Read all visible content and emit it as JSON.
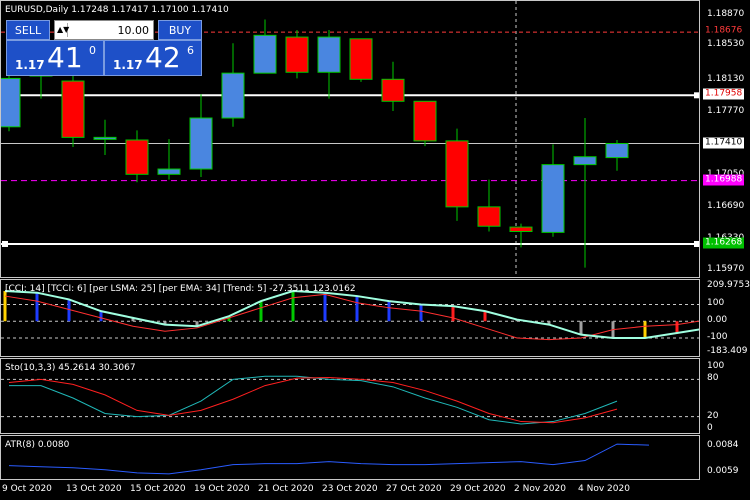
{
  "chart_data": {
    "type": "candlestick",
    "symbol_header": "EURUSD,Daily  1.17248 1.17417 1.17100 1.17410",
    "x_labels": [
      "9 Oct 2020",
      "13 Oct 2020",
      "15 Oct 2020",
      "19 Oct 2020",
      "21 Oct 2020",
      "23 Oct 2020",
      "27 Oct 2020",
      "29 Oct 2020",
      "2 Nov 2020",
      "4 Nov 2020"
    ],
    "ylim": [
      1.1587,
      1.1903
    ],
    "candles": [
      {
        "o": 1.176,
        "h": 1.1825,
        "l": 1.1755,
        "c": 1.1815
      },
      {
        "o": 1.182,
        "h": 1.1836,
        "l": 1.1792,
        "c": 1.1818
      },
      {
        "o": 1.1812,
        "h": 1.1822,
        "l": 1.1737,
        "c": 1.1748
      },
      {
        "o": 1.1748,
        "h": 1.1768,
        "l": 1.1728,
        "c": 1.1748
      },
      {
        "o": 1.1745,
        "h": 1.1756,
        "l": 1.1697,
        "c": 1.1706
      },
      {
        "o": 1.1706,
        "h": 1.1746,
        "l": 1.17,
        "c": 1.1712
      },
      {
        "o": 1.1712,
        "h": 1.1797,
        "l": 1.1703,
        "c": 1.177
      },
      {
        "o": 1.177,
        "h": 1.1855,
        "l": 1.176,
        "c": 1.1821
      },
      {
        "o": 1.1821,
        "h": 1.1882,
        "l": 1.1821,
        "c": 1.1864
      },
      {
        "o": 1.1862,
        "h": 1.187,
        "l": 1.1815,
        "c": 1.1822
      },
      {
        "o": 1.1822,
        "h": 1.187,
        "l": 1.1792,
        "c": 1.1862
      },
      {
        "o": 1.186,
        "h": 1.186,
        "l": 1.1811,
        "c": 1.1814
      },
      {
        "o": 1.1814,
        "h": 1.1834,
        "l": 1.1778,
        "c": 1.1789
      },
      {
        "o": 1.1789,
        "h": 1.1789,
        "l": 1.1738,
        "c": 1.1744
      },
      {
        "o": 1.1744,
        "h": 1.1758,
        "l": 1.1653,
        "c": 1.1669
      },
      {
        "o": 1.1669,
        "h": 1.17,
        "l": 1.1641,
        "c": 1.1647
      },
      {
        "o": 1.1646,
        "h": 1.165,
        "l": 1.1623,
        "c": 1.1641
      },
      {
        "o": 1.164,
        "h": 1.174,
        "l": 1.1635,
        "c": 1.1717
      },
      {
        "o": 1.1717,
        "h": 1.177,
        "l": 1.16,
        "c": 1.1726
      },
      {
        "o": 1.1725,
        "h": 1.1745,
        "l": 1.171,
        "c": 1.1741
      }
    ],
    "price_ticks": [
      "1.18870",
      "1.18530",
      "1.18130",
      "1.17770",
      "1.17410",
      "1.17050",
      "1.16690",
      "1.16330",
      "1.15970"
    ],
    "price_tags": [
      {
        "text": "1.18676",
        "value": 1.18676,
        "bg": "#000000",
        "fg": "#ff3b3b",
        "line": "#ff3b3b"
      },
      {
        "text": "1.17958",
        "value": 1.17958,
        "bg": "#ffffff",
        "fg": "#e00000",
        "line": "#ffffff"
      },
      {
        "text": "1.17410",
        "value": 1.1741,
        "bg": "#ffffff",
        "fg": "#000000",
        "line": "#c8c8c8"
      },
      {
        "text": "1.16988",
        "value": 1.16988,
        "bg": "#ff00ff",
        "fg": "#ffffff",
        "line": "#ff00ff"
      },
      {
        "text": "1.16268",
        "value": 1.16268,
        "bg": "#00c000",
        "fg": "#ffffff",
        "line": "#ffffff"
      }
    ],
    "hlines": [
      {
        "value": 1.18676,
        "color": "#ff3b3b",
        "dash": "4,3",
        "width": 1
      },
      {
        "value": 1.17958,
        "color": "#ffffff",
        "dash": "",
        "width": 2
      },
      {
        "value": 1.1741,
        "color": "#c8c8c8",
        "dash": "",
        "width": 1
      },
      {
        "value": 1.16988,
        "color": "#ff00ff",
        "dash": "6,4",
        "width": 1
      },
      {
        "value": 1.16268,
        "color": "#ffffff",
        "dash": "",
        "width": 2
      }
    ],
    "cci": {
      "label": "[CCI: 14] [TCCI: 6] [per LSMA: 25] [per EMA: 34] [Trend: 5] -27.3511 123.0162",
      "ylim": [
        -183.409,
        209.9753
      ],
      "ticks": [
        "209.9753",
        "100",
        "0.00",
        "-100",
        "-183.409"
      ],
      "cci": [
        150,
        120,
        70,
        20,
        -30,
        -60,
        -40,
        20,
        80,
        140,
        160,
        110,
        80,
        60,
        20,
        -40,
        -100,
        -110,
        -100,
        -50,
        -30,
        -20,
        10,
        70
      ],
      "tcci": [
        180,
        170,
        130,
        60,
        20,
        -20,
        -30,
        30,
        120,
        180,
        170,
        150,
        120,
        100,
        90,
        60,
        10,
        -20,
        -80,
        -100,
        -100,
        -70,
        -40,
        -20
      ],
      "hist_colors": [
        "yellow",
        "blue",
        "blue",
        "blue",
        "gray",
        "gray",
        "gray",
        "green",
        "green",
        "green",
        "blue",
        "blue",
        "blue",
        "blue",
        "red",
        "red",
        "gray",
        "gray",
        "gray",
        "gray",
        "yellow",
        "red",
        "red",
        "red"
      ]
    },
    "sto": {
      "label": "Sto(10,3,3) 45.2614 30.3067",
      "ticks": [
        "100",
        "80",
        "20",
        "0"
      ],
      "ylim": [
        0,
        100
      ],
      "main": [
        70,
        70,
        50,
        25,
        20,
        22,
        45,
        80,
        85,
        85,
        80,
        78,
        68,
        50,
        35,
        15,
        8,
        12,
        25,
        45
      ],
      "signal": [
        75,
        80,
        72,
        55,
        30,
        22,
        30,
        48,
        70,
        82,
        83,
        80,
        75,
        62,
        45,
        25,
        12,
        10,
        18,
        32
      ]
    },
    "atr": {
      "label": "ATR(8) 0.0080",
      "ticks": [
        "0.0084",
        "0.0059"
      ],
      "ylim": [
        0.0053,
        0.009
      ],
      "values": [
        0.0065,
        0.0064,
        0.0063,
        0.0061,
        0.0058,
        0.0057,
        0.0061,
        0.0066,
        0.0067,
        0.0067,
        0.0069,
        0.0067,
        0.0066,
        0.0066,
        0.0067,
        0.0068,
        0.0069,
        0.0066,
        0.007,
        0.0086,
        0.0085
      ]
    }
  },
  "trade_panel": {
    "sell_label": "SELL",
    "buy_label": "BUY",
    "lot": "10.00",
    "lot_arrow": "▲▼",
    "bid_small": "1.17",
    "bid_big": "41",
    "bid_sup": "0",
    "ask_small": "1.17",
    "ask_big": "42",
    "ask_sup": "6"
  },
  "colors": {
    "bull": "#4a86e0",
    "bear": "#ff0000",
    "wick": "#00c800",
    "grid": "#808080"
  }
}
